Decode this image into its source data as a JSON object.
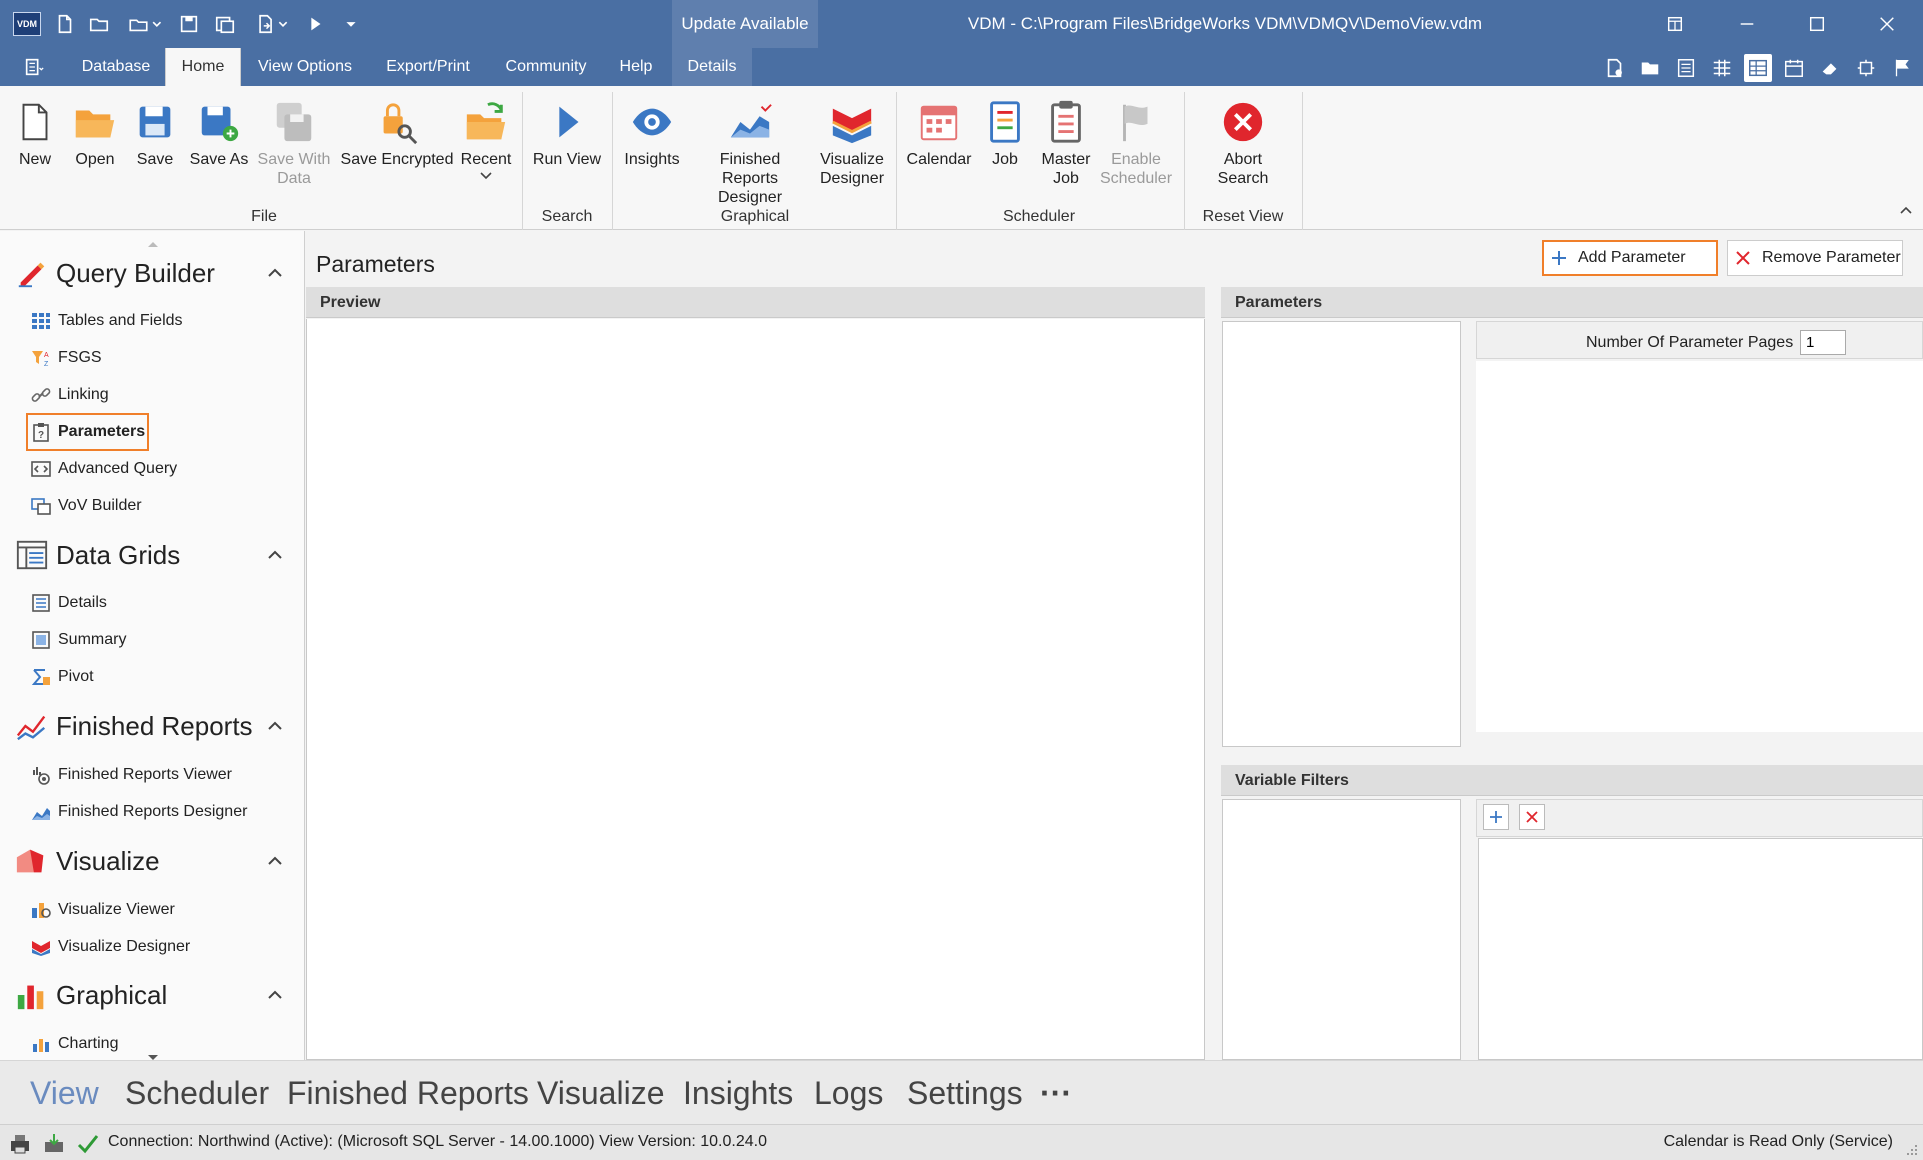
{
  "app": {
    "logo_text": "VDM",
    "window_title": "VDM - C:\\Program Files\\BridgeWorks VDM\\VDMQV\\DemoView.vdm",
    "update_badge": "Update Available"
  },
  "menu": {
    "tabs": [
      "Database",
      "Home",
      "View Options",
      "Export/Print",
      "Community",
      "Help",
      "Details"
    ],
    "active_tab": "Home"
  },
  "ribbon": {
    "file": {
      "group_label": "File",
      "new": "New",
      "open": "Open",
      "save": "Save",
      "save_as": "Save As",
      "save_with_data_1": "Save With",
      "save_with_data_2": "Data",
      "save_encrypted": "Save Encrypted",
      "recent": "Recent"
    },
    "search": {
      "group_label": "Search",
      "run_view": "Run View"
    },
    "graphical": {
      "group_label": "Graphical",
      "insights": "Insights",
      "frd_1": "Finished Reports",
      "frd_2": "Designer",
      "vd_1": "Visualize",
      "vd_2": "Designer"
    },
    "scheduler": {
      "group_label": "Scheduler",
      "calendar": "Calendar",
      "job": "Job",
      "master_1": "Master",
      "master_2": "Job",
      "enable_1": "Enable",
      "enable_2": "Scheduler"
    },
    "reset": {
      "group_label": "Reset View",
      "abort_1": "Abort",
      "abort_2": "Search"
    }
  },
  "sidebar": {
    "sections": [
      {
        "title": "Query Builder",
        "items": [
          "Tables and Fields",
          "FSGS",
          "Linking",
          "Parameters",
          "Advanced Query",
          "VoV Builder"
        ]
      },
      {
        "title": "Data Grids",
        "items": [
          "Details",
          "Summary",
          "Pivot"
        ]
      },
      {
        "title": "Finished Reports",
        "items": [
          "Finished Reports Viewer",
          "Finished Reports Designer"
        ]
      },
      {
        "title": "Visualize",
        "items": [
          "Visualize Viewer",
          "Visualize Designer"
        ]
      },
      {
        "title": "Graphical",
        "items": [
          "Charting"
        ]
      }
    ],
    "selected_item": "Parameters"
  },
  "main": {
    "heading": "Parameters",
    "add_button": "Add Parameter",
    "remove_button": "Remove Parameter",
    "preview_header": "Preview",
    "parameters_header": "Parameters",
    "num_pages_label": "Number Of Parameter Pages",
    "num_pages_value": "1",
    "variable_filters_header": "Variable Filters"
  },
  "bottom_nav": {
    "tabs": [
      "View",
      "Scheduler",
      "Finished Reports",
      "Visualize",
      "Insights",
      "Logs",
      "Settings"
    ],
    "more": "···",
    "active_tab": "View"
  },
  "status": {
    "connection": "Connection: Northwind (Active): (Microsoft SQL Server - 14.00.1000) View Version: 10.0.24.0",
    "calendar_note": "Calendar is Read Only (Service)"
  },
  "colors": {
    "titlebar": "#4a6fa3",
    "highlight": "#f07f2a",
    "active_nav": "#6a8bbf",
    "abort_red": "#e0262d"
  }
}
